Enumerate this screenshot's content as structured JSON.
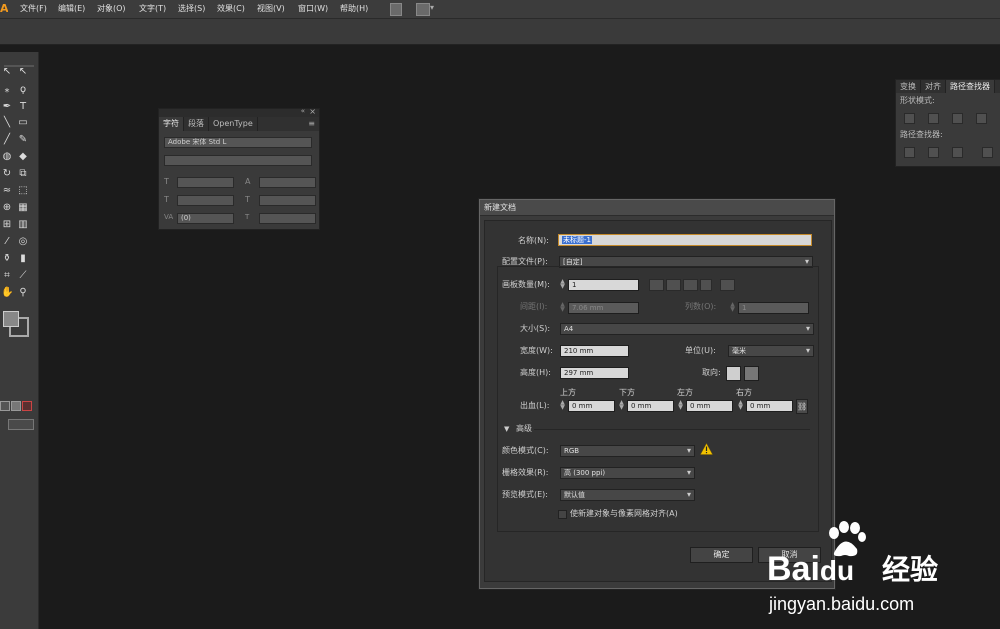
{
  "app": {
    "logo": "Ai"
  },
  "menu": [
    {
      "label": "文件(F)"
    },
    {
      "label": "编辑(E)"
    },
    {
      "label": "对象(O)"
    },
    {
      "label": "文字(T)"
    },
    {
      "label": "选择(S)"
    },
    {
      "label": "效果(C)"
    },
    {
      "label": "视图(V)"
    },
    {
      "label": "窗口(W)"
    },
    {
      "label": "帮助(H)"
    }
  ],
  "char_panel": {
    "tabs": [
      "字符",
      "段落",
      "OpenType"
    ],
    "font_family": "Adobe 宋体 Std L",
    "font_style": "",
    "tracking_value": "(0)"
  },
  "right_panel": {
    "tabs": [
      "变换",
      "对齐",
      "路径查找器"
    ],
    "shape_modes_label": "形状模式:",
    "pathfinder_label": "路径查找器:"
  },
  "dialog": {
    "title": "新建文档",
    "name_label": "名称(N):",
    "name_value": "未标题-1",
    "profile_label": "配置文件(P):",
    "profile_value": "[自定]",
    "artboards_label": "画板数量(M):",
    "artboards_value": "1",
    "spacing_label": "间距(I):",
    "spacing_value": "7.06 mm",
    "columns_label": "列数(O):",
    "columns_value": "1",
    "size_label": "大小(S):",
    "size_value": "A4",
    "width_label": "宽度(W):",
    "width_value": "210 mm",
    "units_label": "单位(U):",
    "units_value": "毫米",
    "height_label": "高度(H):",
    "height_value": "297 mm",
    "orientation_label": "取向:",
    "bleed_label": "出血(L):",
    "bleed_top_label": "上方",
    "bleed_bottom_label": "下方",
    "bleed_left_label": "左方",
    "bleed_right_label": "右方",
    "bleed_top": "0 mm",
    "bleed_bottom": "0 mm",
    "bleed_left": "0 mm",
    "bleed_right": "0 mm",
    "advanced_label": "高级",
    "color_mode_label": "颜色模式(C):",
    "color_mode_value": "RGB",
    "raster_label": "栅格效果(R):",
    "raster_value": "高 (300 ppi)",
    "preview_label": "预览模式(E):",
    "preview_value": "默认值",
    "align_checkbox_label": "使新建对象与像素网格对齐(A)",
    "ok_label": "确定",
    "cancel_label": "取消"
  },
  "watermark": {
    "brand": "Bai",
    "brand2": "du",
    "product": "经验",
    "url": "jingyan.baidu.com"
  },
  "colors": {
    "accent": "#f39a1e",
    "dialog_bg": "#3b3b3b",
    "canvas": "#1b1b1b",
    "warning": "#f2c200"
  }
}
